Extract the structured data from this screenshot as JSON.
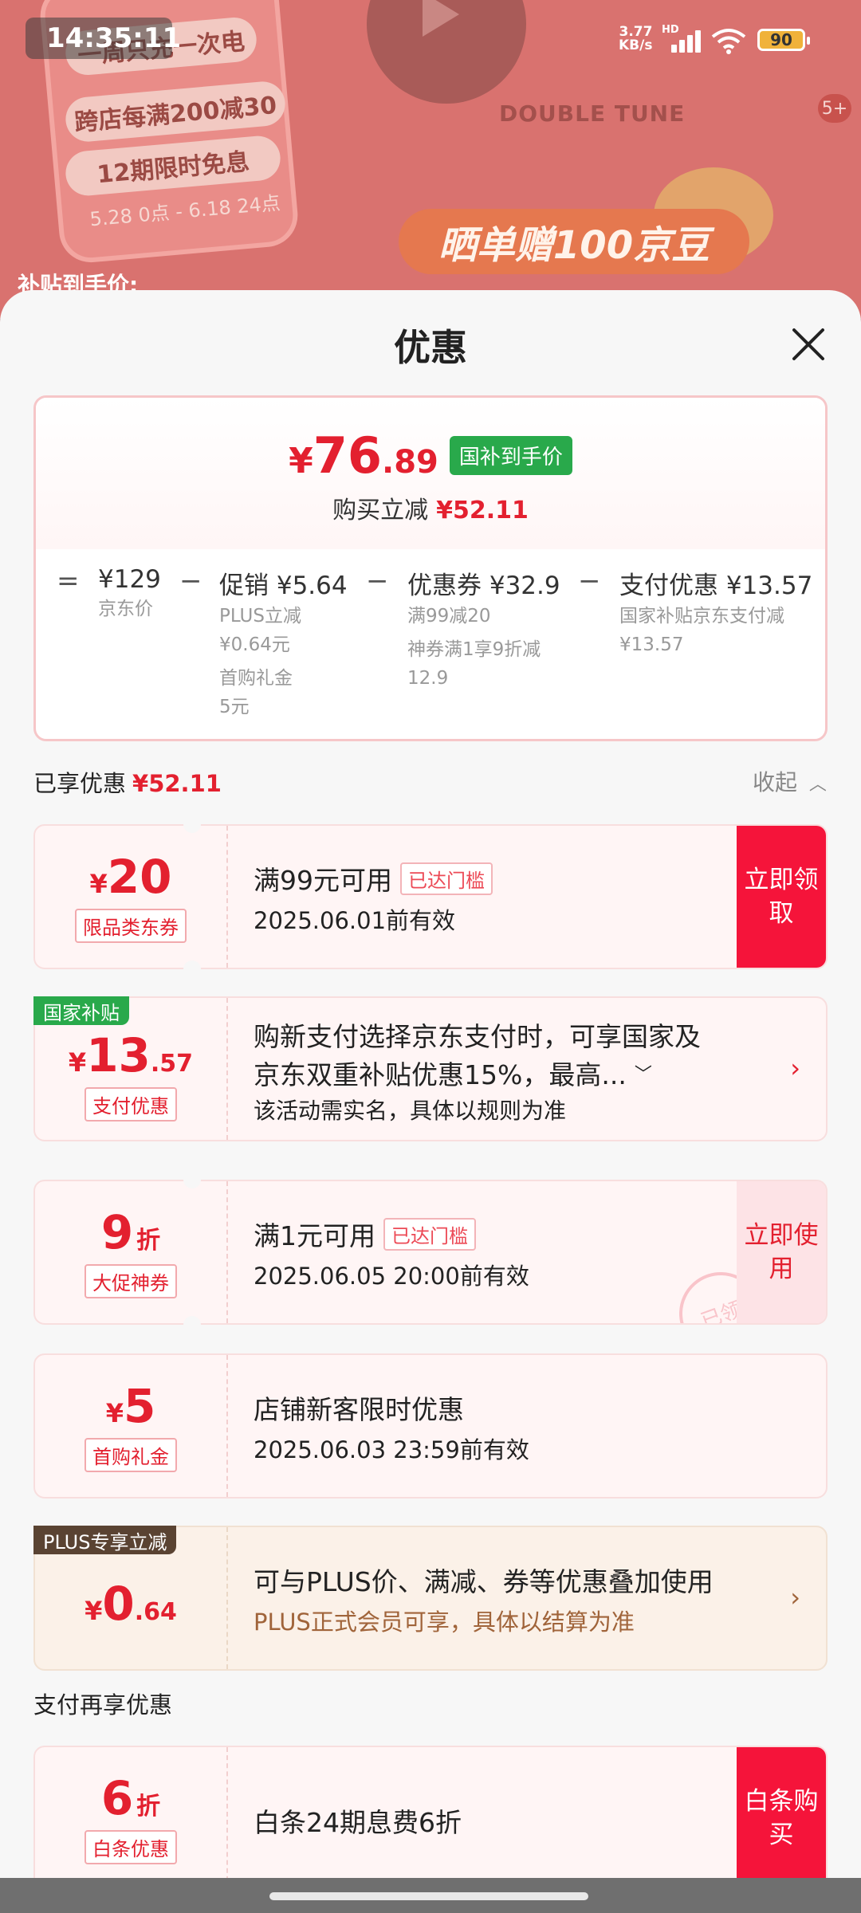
{
  "status_bar": {
    "time": "14:35:11",
    "net_speed": "3.77",
    "net_unit": "KB/s",
    "signal_label": "HD",
    "battery": "90"
  },
  "background": {
    "pill_1": "一周只充一次电",
    "pill_2": "跨店每满200减30",
    "pill_3": "12期限时免息",
    "date_range": "5.28 0点 - 6.18 24点",
    "brand": "DOUBLE TUNE",
    "badge": "5+",
    "banner": "晒单赠100京豆",
    "subsidy_label": "补贴到手价:"
  },
  "sheet": {
    "title": "优惠"
  },
  "summary": {
    "currency": "¥",
    "price_int": "76",
    "price_dec": ".89",
    "gov_tag": "国补到手价",
    "reduce_label": "购买立减",
    "reduce_value": "¥52.11",
    "breakdown": [
      {
        "op": "=",
        "main": "¥129",
        "subs": [
          "京东价"
        ]
      },
      {
        "op": "−",
        "main": "促销 ¥5.64",
        "subs": [
          "PLUS立减",
          "¥0.64元",
          "首购礼金",
          "5元"
        ]
      },
      {
        "op": "−",
        "main": "优惠券 ¥32.9",
        "subs": [
          "满99减20",
          "神券满1享9折减",
          "12.9"
        ]
      },
      {
        "op": "−",
        "main": "支付优惠 ¥13.57",
        "subs": [
          "国家补贴京东支付减",
          "¥13.57"
        ]
      }
    ]
  },
  "enjoyed": {
    "label": "已享优惠",
    "value": "¥52.11",
    "collapse": "收起"
  },
  "coupons": [
    {
      "currency": "¥",
      "amount": "20",
      "decimal": "",
      "unit": "",
      "tag": "限品类东券",
      "title": "满99元可用",
      "chip": "已达门槛",
      "sub": "2025.06.01前有效",
      "cta": "立即领取"
    },
    {
      "corner": "国家补贴",
      "currency": "¥",
      "amount": "13",
      "decimal": ".57",
      "unit": "",
      "tag": "支付优惠",
      "title_line1": "购新支付选择京东支付时，可享国家及",
      "title_line2": "京东双重补贴优惠15%，最高...",
      "sub": "该活动需实名，具体以规则为准"
    },
    {
      "currency": "",
      "amount": "9",
      "decimal": "",
      "unit": "折",
      "tag": "大促神券",
      "title": "满1元可用",
      "chip": "已达门槛",
      "sub": "2025.06.05 20:00前有效",
      "cta": "立即使用",
      "stamp": "已领"
    },
    {
      "currency": "¥",
      "amount": "5",
      "decimal": "",
      "unit": "",
      "tag": "首购礼金",
      "title": "店铺新客限时优惠",
      "sub": "2025.06.03 23:59前有效"
    },
    {
      "corner": "PLUS专享立减",
      "currency": "¥",
      "amount": "0",
      "decimal": ".64",
      "unit": "",
      "title": "可与PLUS价、满减、券等优惠叠加使用",
      "sub": "PLUS正式会员可享，具体以结算为准"
    }
  ],
  "pay_section": {
    "label": "支付再享优惠"
  },
  "pay_coupon": {
    "amount": "6",
    "unit": "折",
    "tag": "白条优惠",
    "title": "白条24期息费6折",
    "cta": "白条购买"
  },
  "colors": {
    "accent_red": "#e3202f",
    "cta_red": "#f5143a",
    "gov_green": "#29a94b",
    "plus_brown": "#5a4332"
  }
}
